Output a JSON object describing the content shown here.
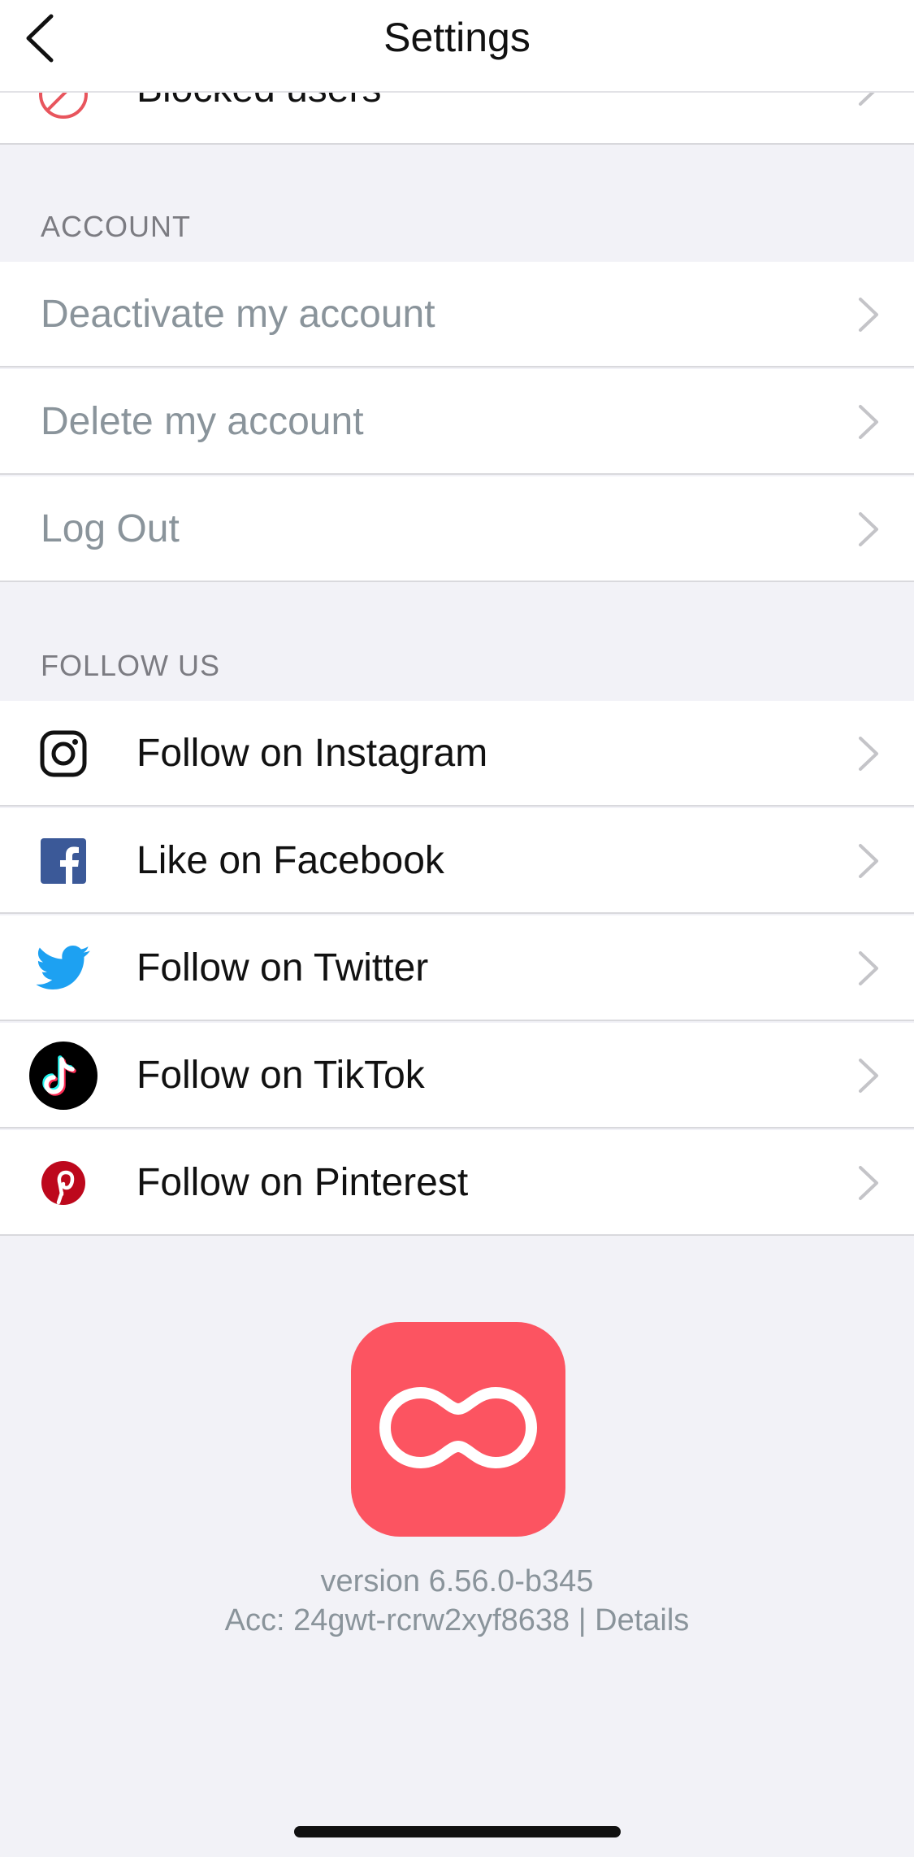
{
  "nav": {
    "title": "Settings",
    "back_icon": "chevron-left-icon"
  },
  "partial_row": {
    "label": "Blocked users",
    "icon": "blocked-icon",
    "icon_color": "#e8555d"
  },
  "account_section": {
    "header": "ACCOUNT",
    "items": [
      {
        "label": "Deactivate my account"
      },
      {
        "label": "Delete my account"
      },
      {
        "label": "Log Out"
      }
    ]
  },
  "follow_section": {
    "header": "FOLLOW US",
    "items": [
      {
        "label": "Follow on Instagram",
        "icon": "instagram-icon"
      },
      {
        "label": "Like on Facebook",
        "icon": "facebook-icon",
        "color": "#3b5998"
      },
      {
        "label": "Follow on Twitter",
        "icon": "twitter-icon",
        "color": "#1da1f2"
      },
      {
        "label": "Follow on TikTok",
        "icon": "tiktok-icon"
      },
      {
        "label": "Follow on Pinterest",
        "icon": "pinterest-icon",
        "color": "#bd081c"
      }
    ]
  },
  "footer": {
    "logo_icon": "app-logo-icon",
    "logo_color": "#fc5461",
    "version": "version 6.56.0-b345",
    "account_prefix": "Acc: 24gwt-rcrw2xyf8638 | ",
    "details_label": "Details"
  },
  "colors": {
    "background": "#f2f2f7",
    "muted_text": "#8a949b",
    "primary_text": "#111111"
  }
}
